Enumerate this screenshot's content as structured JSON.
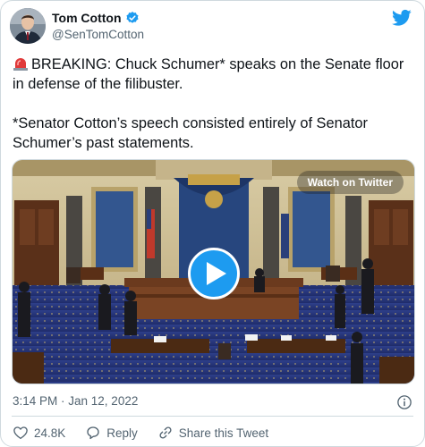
{
  "author": {
    "display_name": "Tom Cotton",
    "handle": "@SenTomCotton",
    "verified": true,
    "avatar_icon": "avatar-portrait"
  },
  "tweet": {
    "line1": "BREAKING: Chuck Schumer* speaks on the Senate floor in defense of the filibuster.",
    "line2": "*Senator Cotton’s speech consisted entirely of Senator Schumer’s past statements.",
    "leading_icon": "siren-emoji"
  },
  "media": {
    "watch_label": "Watch on Twitter",
    "play_icon": "play-icon"
  },
  "meta": {
    "timestamp": "3:14 PM · Jan 12, 2022"
  },
  "actions": {
    "like_count": "24.8K",
    "reply_label": "Reply",
    "share_label": "Share this Tweet"
  },
  "colors": {
    "accent": "#1d9bf0",
    "text": "#0f1419",
    "secondary": "#536471",
    "border": "#cfd9de"
  }
}
